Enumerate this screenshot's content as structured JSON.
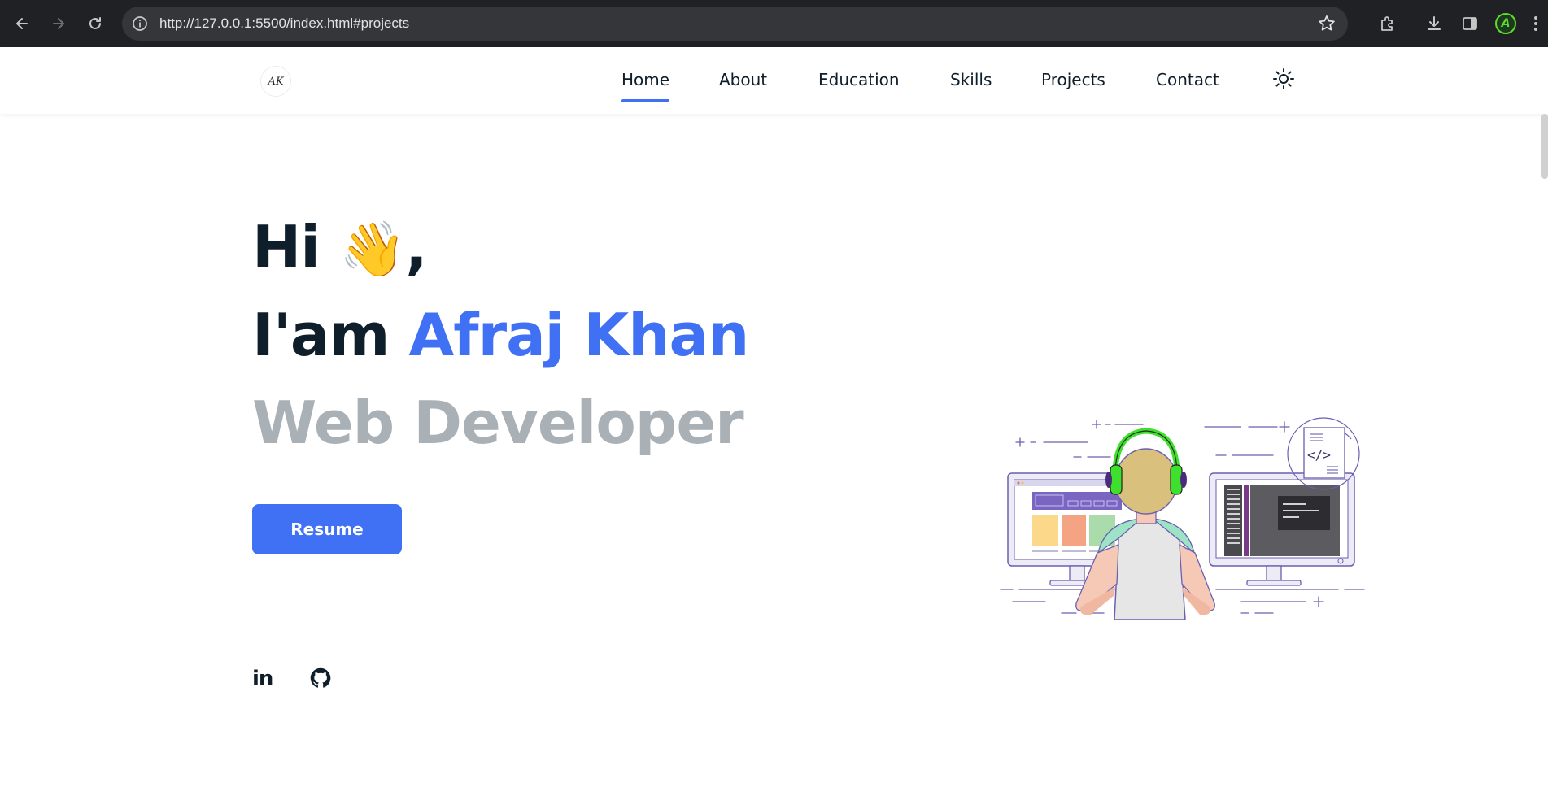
{
  "browser": {
    "url": "http://127.0.0.1:5500/index.html#projects",
    "back_icon": "arrow-left-icon",
    "forward_icon": "arrow-right-icon",
    "reload_icon": "reload-icon",
    "bookmark_icon": "star-icon",
    "profile_initial": "A"
  },
  "site": {
    "logo_text": "AK",
    "nav": [
      {
        "label": "Home",
        "active": true
      },
      {
        "label": "About"
      },
      {
        "label": "Education"
      },
      {
        "label": "Skills"
      },
      {
        "label": "Projects"
      },
      {
        "label": "Contact"
      }
    ],
    "theme_icon": "sun-icon"
  },
  "hero": {
    "greeting": "Hi",
    "wave": "👋",
    "comma": ",",
    "intro": "I'am",
    "name": "Afraj Khan",
    "role": "Web Developer",
    "resume_label": "Resume",
    "linkedin_text": "in"
  },
  "colors": {
    "accent": "#4070f4",
    "text_dark": "#0f1e2b",
    "text_muted": "#a9b0b6",
    "headphones": "#3de02a"
  }
}
